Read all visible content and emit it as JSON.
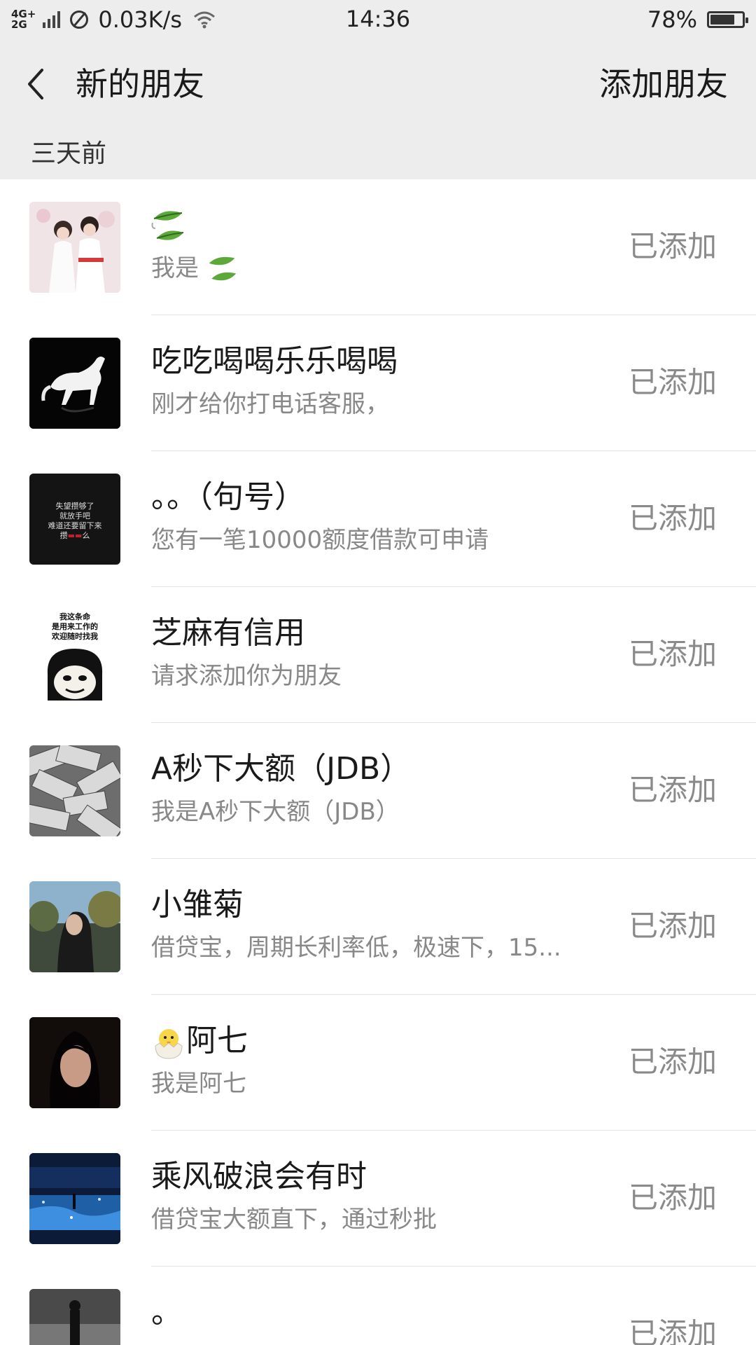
{
  "status_bar": {
    "network_top": "4G+",
    "network_bottom": "2G",
    "speed": "0.03K/s",
    "time": "14:36",
    "battery_text": "78%",
    "battery_level": 0.78
  },
  "nav": {
    "title": "新的朋友",
    "add_label": "添加朋友"
  },
  "section": {
    "label": "三天前"
  },
  "friends": [
    {
      "name": "",
      "message": "我是",
      "status": "已添加",
      "avatar": "couple-photo",
      "name_icon": "leaf-emoji",
      "message_icon": "leaf-emoji"
    },
    {
      "name": "吃吃喝喝乐乐喝喝",
      "message": "刚才给你打电话客服，",
      "status": "已添加",
      "avatar": "white-horse"
    },
    {
      "name": "。。（句号）",
      "message": "您有一笔10000额度借款可申请",
      "status": "已添加",
      "avatar": "black-text-card",
      "avatar_text": [
        "失望攒够了",
        "就放手吧",
        "难道还要留下来",
        "攒",
        "么"
      ]
    },
    {
      "name": "芝麻有信用",
      "message": "请求添加你为朋友",
      "status": "已添加",
      "avatar": "meme-face",
      "avatar_text": [
        "我这条命",
        "是用来工作的",
        "欢迎随时找我"
      ]
    },
    {
      "name": "A秒下大额（JDB）",
      "message": "我是A秒下大额（JDB）",
      "status": "已添加",
      "avatar": "money-pile"
    },
    {
      "name": "小雏菊",
      "message": "借贷宝，周期长利率低，极速下，15...",
      "status": "已添加",
      "avatar": "girl-outdoor"
    },
    {
      "name": "阿七",
      "message": "我是阿七",
      "status": "已添加",
      "avatar": "girl-dark",
      "name_icon": "chick-emoji"
    },
    {
      "name": "乘风破浪会有时",
      "message": "借贷宝大额直下，通过秒批",
      "status": "已添加",
      "avatar": "blue-night"
    },
    {
      "name": "。",
      "message": "",
      "status": "已添加",
      "avatar": "street-photo"
    }
  ],
  "colors": {
    "header_bg": "#ededed",
    "text_primary": "#1a1a1a",
    "text_secondary": "#888888",
    "status_text": "#8a8a8a"
  }
}
